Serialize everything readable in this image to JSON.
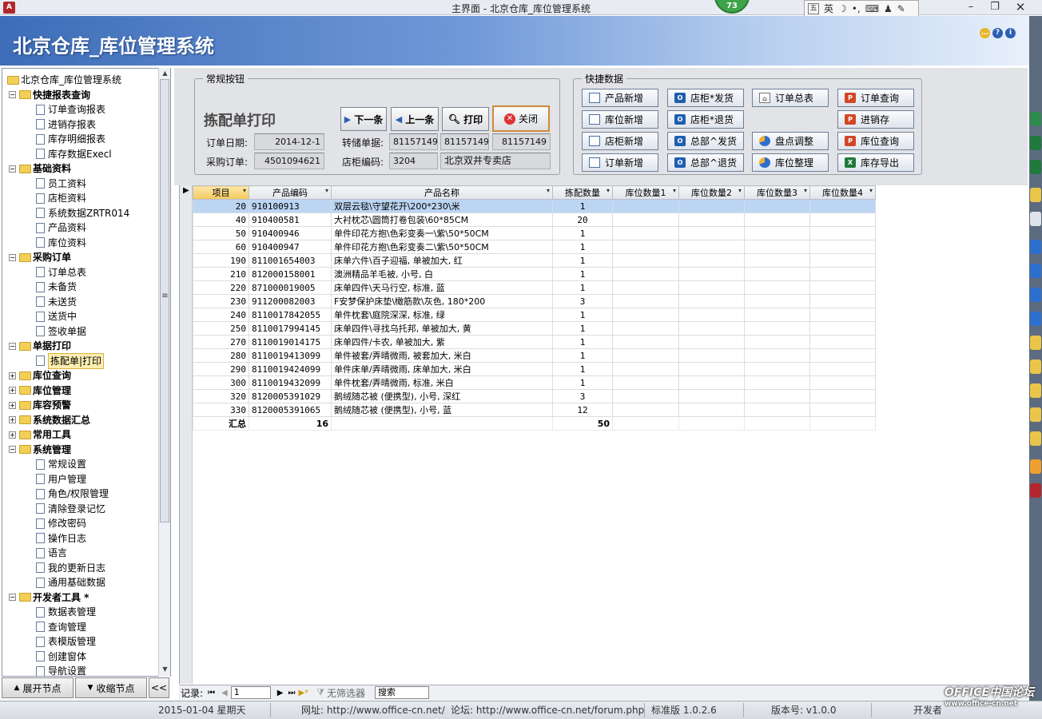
{
  "window": {
    "title": "主界面 - 北京仓库_库位管理系统",
    "badge": "73",
    "ime": {
      "lang": "英"
    }
  },
  "header": {
    "app_title": "北京仓库_库位管理系统"
  },
  "nav": {
    "items": [
      {
        "label": "北京仓库_库位管理系统",
        "level": 0,
        "kind": "root"
      },
      {
        "label": "快捷报表查询",
        "level": 1,
        "kind": "group",
        "expanded": true
      },
      {
        "label": "订单查询报表",
        "level": 2
      },
      {
        "label": "进销存报表",
        "level": 2
      },
      {
        "label": "库存明细报表",
        "level": 2
      },
      {
        "label": "库存数据Execl",
        "level": 2
      },
      {
        "label": "基础资料",
        "level": 1,
        "kind": "group",
        "expanded": true
      },
      {
        "label": "员工资料",
        "level": 2
      },
      {
        "label": "店柜资料",
        "level": 2
      },
      {
        "label": "系统数据ZRTR014",
        "level": 2
      },
      {
        "label": "产品资料",
        "level": 2
      },
      {
        "label": "库位资料",
        "level": 2
      },
      {
        "label": "采购订单",
        "level": 1,
        "kind": "group",
        "expanded": true
      },
      {
        "label": "订单总表",
        "level": 2
      },
      {
        "label": "未备货",
        "level": 2
      },
      {
        "label": "未送货",
        "level": 2
      },
      {
        "label": "送货中",
        "level": 2
      },
      {
        "label": "签收单据",
        "level": 2
      },
      {
        "label": "单据打印",
        "level": 1,
        "kind": "group",
        "expanded": true
      },
      {
        "label": "拣配单|打印",
        "level": 2,
        "selected": true
      },
      {
        "label": "库位查询",
        "level": 1,
        "kind": "group",
        "expanded": false
      },
      {
        "label": "库位管理",
        "level": 1,
        "kind": "group",
        "expanded": false
      },
      {
        "label": "库容预警",
        "level": 1,
        "kind": "group",
        "expanded": false
      },
      {
        "label": "系统数据汇总",
        "level": 1,
        "kind": "group",
        "expanded": false
      },
      {
        "label": "常用工具",
        "level": 1,
        "kind": "group",
        "expanded": false
      },
      {
        "label": "系统管理",
        "level": 1,
        "kind": "group",
        "expanded": true
      },
      {
        "label": "常规设置",
        "level": 2
      },
      {
        "label": "用户管理",
        "level": 2
      },
      {
        "label": "角色/权限管理",
        "level": 2
      },
      {
        "label": "清除登录记忆",
        "level": 2
      },
      {
        "label": "修改密码",
        "level": 2
      },
      {
        "label": "操作日志",
        "level": 2
      },
      {
        "label": "语言",
        "level": 2
      },
      {
        "label": "我的更新日志",
        "level": 2
      },
      {
        "label": "通用基础数据",
        "level": 2
      },
      {
        "label": "开发者工具  *",
        "level": 1,
        "kind": "group",
        "expanded": true
      },
      {
        "label": "数据表管理",
        "level": 2
      },
      {
        "label": "查询管理",
        "level": 2
      },
      {
        "label": "表模版管理",
        "level": 2
      },
      {
        "label": "创建窗体",
        "level": 2
      },
      {
        "label": "导航设置",
        "level": 2
      }
    ],
    "expand_all": "展开节点",
    "collapse_all": "收缩节点",
    "hide": "<<"
  },
  "form": {
    "group_title": "常规按钮",
    "title": "拣配单打印",
    "order_date_label": "订单日期:",
    "order_date": "2014-12-1",
    "po_label": "采购订单:",
    "po": "4501094621",
    "transfer_label": "转储单据:",
    "transfer": [
      "81157149",
      "81157149",
      "81157149"
    ],
    "store_label": "店柜编码:",
    "store_code": "3204",
    "store_name": "北京双井专卖店",
    "btn_next": "下一条",
    "btn_prev": "上一条",
    "btn_print": "打印",
    "btn_close": "关闭"
  },
  "quick": {
    "title": "快捷数据",
    "buttons": [
      {
        "label": "产品新增",
        "icon": "window-icon"
      },
      {
        "label": "店柜*发货",
        "icon": "outlook-icon"
      },
      {
        "label": "订单总表",
        "icon": "home-icon"
      },
      {
        "label": "订单查询",
        "icon": "powerpoint-icon"
      },
      {
        "label": "库位新增",
        "icon": "window-icon"
      },
      {
        "label": "店柜*退货",
        "icon": "outlook-icon"
      },
      {
        "label": "进销存",
        "icon": "powerpoint-icon"
      },
      {
        "label": "店柜新增",
        "icon": "window-icon"
      },
      {
        "label": "总部^发货",
        "icon": "outlook-icon"
      },
      {
        "label": "盘点调整",
        "icon": "pie-chart-icon"
      },
      {
        "label": "库位查询",
        "icon": "powerpoint-icon"
      },
      {
        "label": "订单新增",
        "icon": "window-icon"
      },
      {
        "label": "总部^退货",
        "icon": "outlook-icon"
      },
      {
        "label": "库位整理",
        "icon": "pie-chart-icon"
      },
      {
        "label": "库存导出",
        "icon": "excel-icon"
      }
    ]
  },
  "table": {
    "columns": [
      "项目",
      "产品编码",
      "产品名称",
      "拣配数量",
      "库位数量1",
      "库位数量2",
      "库位数量3",
      "库位数量4"
    ],
    "rows": [
      [
        "20",
        "910100913",
        "双层云毯\\守望花开\\200*230\\米",
        "1"
      ],
      [
        "40",
        "910400581",
        "大衬枕芯\\圆筒打卷包装\\60*85CM",
        "20"
      ],
      [
        "50",
        "910400946",
        "单件印花方抱\\色彩变奏一\\紫\\50*50CM",
        "1"
      ],
      [
        "60",
        "910400947",
        "单件印花方抱\\色彩变奏二\\紫\\50*50CM",
        "1"
      ],
      [
        "190",
        "811001654003",
        "床单六件\\百子迎福, 单被加大, 红",
        "1"
      ],
      [
        "210",
        "812000158001",
        "澳洲精品羊毛被, 小号, 白",
        "1"
      ],
      [
        "220",
        "871000019005",
        "床单四件\\天马行空, 标准, 蓝",
        "1"
      ],
      [
        "230",
        "911200082003",
        "F安梦保护床垫\\橄筋款\\灰色, 180*200",
        "3"
      ],
      [
        "240",
        "8110017842055",
        "单件枕套\\庭院深深, 标准, 绿",
        "1"
      ],
      [
        "250",
        "8110017994145",
        "床单四件\\寻找乌托邦, 单被加大, 黄",
        "1"
      ],
      [
        "270",
        "8110019014175",
        "床单四件/卡农, 单被加大, 紫",
        "1"
      ],
      [
        "280",
        "8110019413099",
        "单件被套/弄晴微雨, 被套加大, 米白",
        "1"
      ],
      [
        "290",
        "8110019424099",
        "单件床单/弄晴微雨, 床单加大, 米白",
        "1"
      ],
      [
        "300",
        "8110019432099",
        "单件枕套/弄晴微雨, 标准, 米白",
        "1"
      ],
      [
        "320",
        "8120005391029",
        "鹅绒随芯被 (便携型), 小号, 深红",
        "3"
      ],
      [
        "330",
        "8120005391065",
        "鹅绒随芯被 (便携型), 小号, 蓝",
        "12"
      ]
    ],
    "total_label": "汇总",
    "total_count": "16",
    "total_qty": "50"
  },
  "recnav": {
    "label": "记录:",
    "current": "1",
    "filter": "无筛选器",
    "search": "搜索"
  },
  "status": {
    "date": "2015-01-04 星期天",
    "url": "网址: http://www.office-cn.net/",
    "forum": "论坛: http://www.office-cn.net/forum.php",
    "edition": "标准版 1.0.2.6",
    "version": "版本号: v1.0.0",
    "developer": "开发者"
  },
  "watermark": {
    "line1": "OFFICE中国论坛",
    "line2": "www.office-cn.net"
  }
}
